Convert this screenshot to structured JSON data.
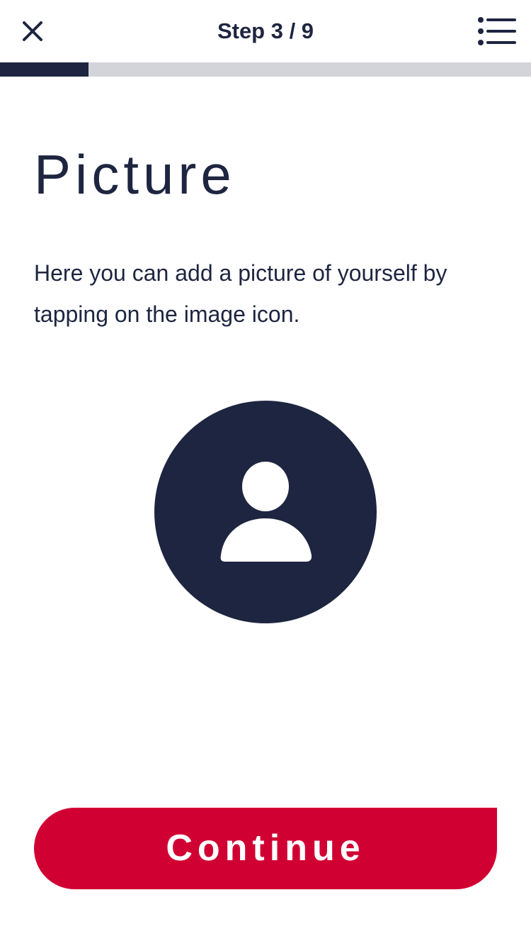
{
  "header": {
    "step_label": "Step 3 / 9",
    "close_icon": "close-icon",
    "menu_icon": "list-menu-icon"
  },
  "progress": {
    "current_step": 3,
    "total_steps": 9,
    "fraction": 0.167
  },
  "main": {
    "title": "Picture",
    "description": "Here you can add a picture of yourself by tapping on the image icon.",
    "avatar_icon": "user-avatar-icon"
  },
  "footer": {
    "continue_label": "Continue"
  },
  "colors": {
    "primary": "#1e2540",
    "accent": "#d10033",
    "track": "#d3d4d9",
    "background": "#ffffff"
  }
}
